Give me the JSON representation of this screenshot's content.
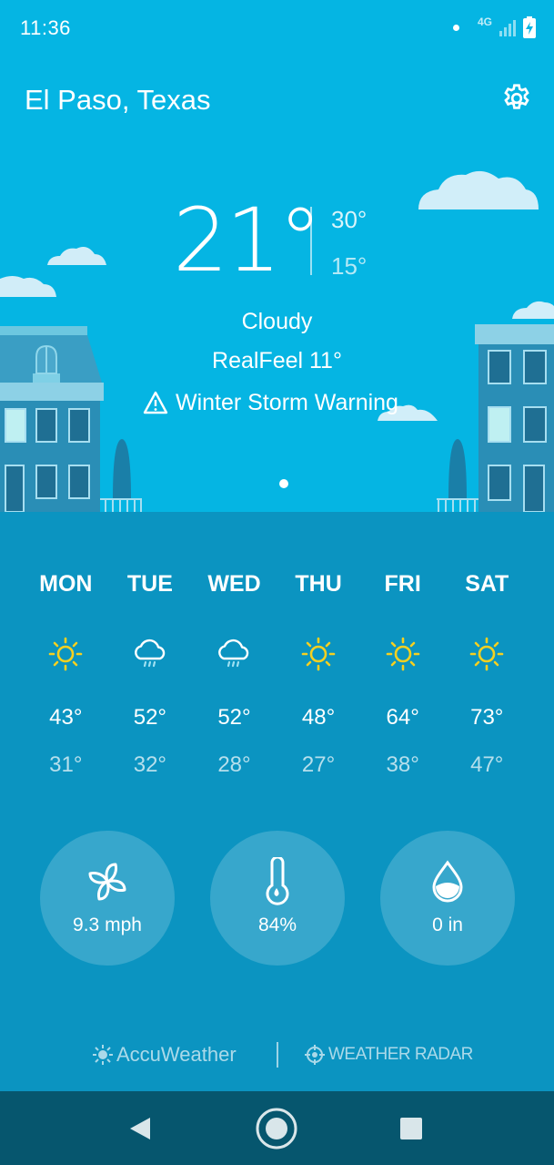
{
  "status_bar": {
    "time": "11:36",
    "network": "4G"
  },
  "location": {
    "city": "El Paso, Texas"
  },
  "current": {
    "temperature": "21°",
    "high": "30°",
    "low": "15°",
    "condition": "Cloudy",
    "realfeel": "RealFeel 11°",
    "alert": "Winter Storm Warning"
  },
  "forecast": [
    {
      "day": "MON",
      "icon": "sun-icon",
      "high": "43°",
      "low": "31°"
    },
    {
      "day": "TUE",
      "icon": "rain-cloud-icon",
      "high": "52°",
      "low": "32°"
    },
    {
      "day": "WED",
      "icon": "rain-cloud-icon",
      "high": "52°",
      "low": "28°"
    },
    {
      "day": "THU",
      "icon": "sun-icon",
      "high": "48°",
      "low": "27°"
    },
    {
      "day": "FRI",
      "icon": "sun-icon",
      "high": "64°",
      "low": "38°"
    },
    {
      "day": "SAT",
      "icon": "sun-icon",
      "high": "73°",
      "low": "47°"
    }
  ],
  "stats": {
    "wind": {
      "icon": "wind-icon",
      "value": "9.3 mph"
    },
    "humidity": {
      "icon": "thermometer-icon",
      "value": "84%"
    },
    "precipitation": {
      "icon": "water-drop-icon",
      "value": "0 in"
    }
  },
  "footer": {
    "accuweather": "AccuWeather",
    "radar": "WEATHER RADAR"
  },
  "colors": {
    "sky": "#05b5e3",
    "forecast_bg": "#0b94c1",
    "navbar": "#06566e",
    "sun": "#f5d020"
  }
}
